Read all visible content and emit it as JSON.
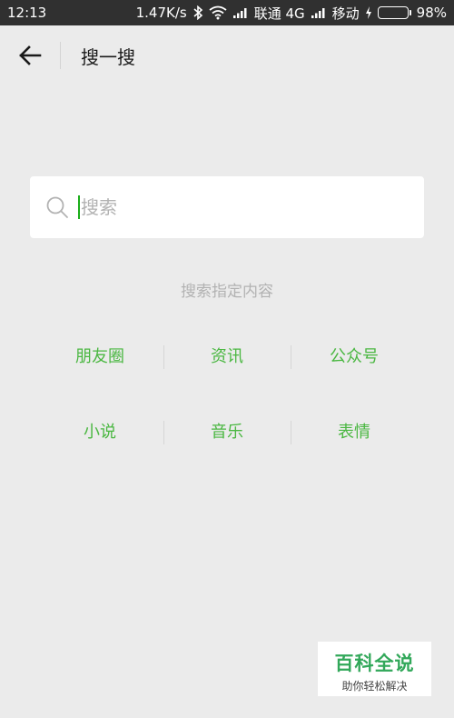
{
  "status_bar": {
    "time": "12:13",
    "network_speed": "1.47K/s",
    "carrier1": "联通 4G",
    "carrier2": "移动",
    "battery": "98%",
    "battery_level": 0.98
  },
  "header": {
    "title": "搜一搜"
  },
  "search": {
    "placeholder": "搜索"
  },
  "hint": "搜索指定内容",
  "categories": [
    [
      "朋友圈",
      "资讯",
      "公众号"
    ],
    [
      "小说",
      "音乐",
      "表情"
    ]
  ],
  "colors": {
    "accent": "#4ab741",
    "background": "#ebebeb",
    "status_bar": "#303030"
  },
  "watermark": {
    "title": "百科全说",
    "subtitle": "助你轻松解决"
  }
}
